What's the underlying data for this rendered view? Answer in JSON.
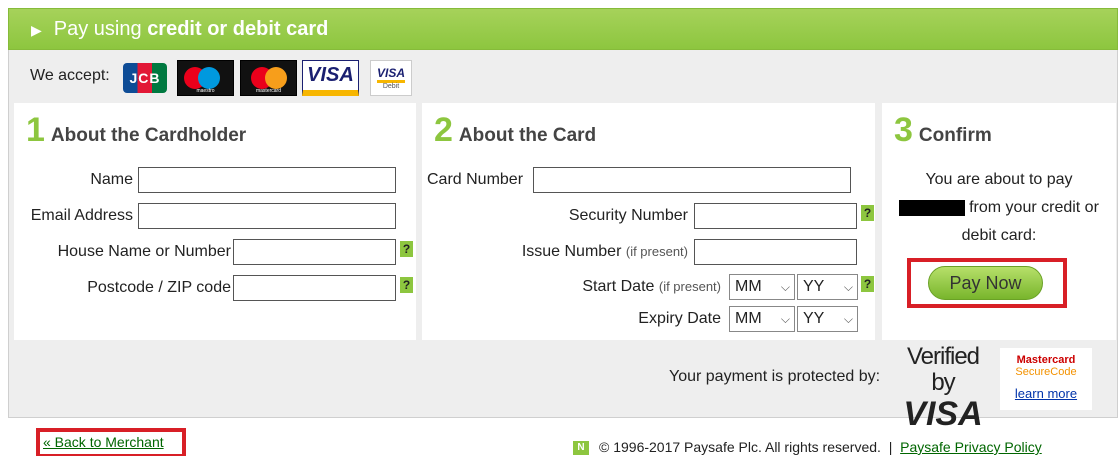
{
  "header": {
    "prefix": "Pay using",
    "bold": "credit or debit card"
  },
  "accept": {
    "label": "We accept:",
    "cards": [
      "JCB",
      "Maestro",
      "Mastercard",
      "VISA",
      "VISA Debit"
    ],
    "jcb_text": "JCB",
    "maestro_sub": "maestro",
    "mastercard_sub": "mastercard",
    "visa_text": "VISA",
    "visa_debit_text": "VISA",
    "visa_debit_sub": "Debit"
  },
  "cardholder": {
    "step": "1",
    "title": "About the Cardholder",
    "name_label": "Name",
    "email_label": "Email Address",
    "house_label": "House Name or Number",
    "postcode_label": "Postcode / ZIP code"
  },
  "card": {
    "step": "2",
    "title": "About the Card",
    "number_label": "Card Number",
    "security_label": "Security Number",
    "issue_label": "Issue Number",
    "issue_note": "(if present)",
    "start_label": "Start Date",
    "start_note": "(if present)",
    "expiry_label": "Expiry Date",
    "month_placeholder": "MM",
    "year_placeholder": "YY"
  },
  "confirm": {
    "step": "3",
    "title": "Confirm",
    "line1": "You are about to pay",
    "line2": "from your credit or",
    "line3": "debit card:",
    "pay_label": "Pay Now"
  },
  "protection": {
    "label": "Your payment is protected by:",
    "vbv_line1": "Verified by",
    "vbv_line2": "VISA",
    "mc_line1": "Mastercard",
    "mc_line2": "SecureCode",
    "mc_learn": "learn more"
  },
  "footer": {
    "back": "« Back to Merchant",
    "copyright": "© 1996-2017 Paysafe Plc. All rights reserved.",
    "separator": "|",
    "privacy": "Paysafe Privacy Policy"
  },
  "help_glyph": "?",
  "chevron_glyph": "⌵",
  "colors": {
    "accent": "#8dc63f",
    "highlight": "#d81f26",
    "link": "#006600"
  }
}
